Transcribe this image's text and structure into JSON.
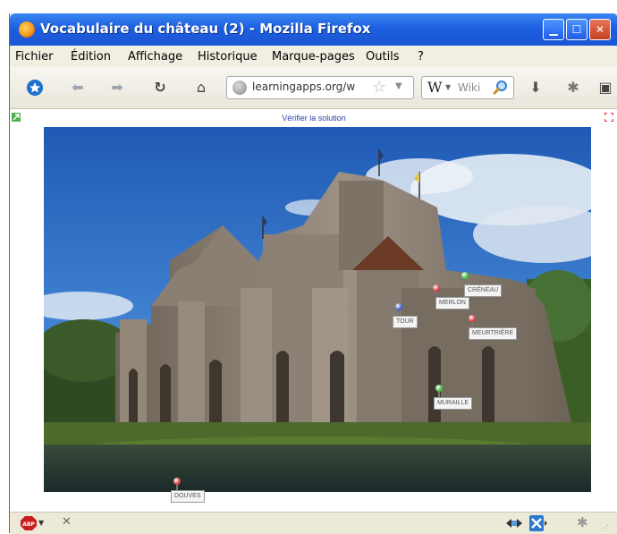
{
  "window": {
    "title": "Vocabulaire du château (2) - Mozilla Firefox"
  },
  "menubar": {
    "items": [
      {
        "label": "Fichier"
      },
      {
        "label": "Édition"
      },
      {
        "label": "Affichage"
      },
      {
        "label": "Historique"
      },
      {
        "label": "Marque-pages"
      },
      {
        "label": "Outils"
      },
      {
        "label": "?"
      }
    ]
  },
  "navbar": {
    "url": "learningapps.org/w",
    "search_placeholder": "Wiki",
    "search_engine_icon": "W"
  },
  "content": {
    "check_link": "Vérifier la solution",
    "pins": [
      {
        "label": "CRÉNEAU",
        "color": "#3fbf3f"
      },
      {
        "label": "MERLON",
        "color": "#e03a3a"
      },
      {
        "label": "TOUR",
        "color": "#3b5fd9"
      },
      {
        "label": "MEURTRIÈRE",
        "color": "#e03a3a"
      },
      {
        "label": "MURAILLE",
        "color": "#3fbf3f"
      },
      {
        "label": "DOUVES",
        "color": "#e03a3a"
      }
    ]
  },
  "colors": {
    "titlebar": "#1d5fe0",
    "chrome": "#ece9d8",
    "link": "#2b3fa8"
  }
}
